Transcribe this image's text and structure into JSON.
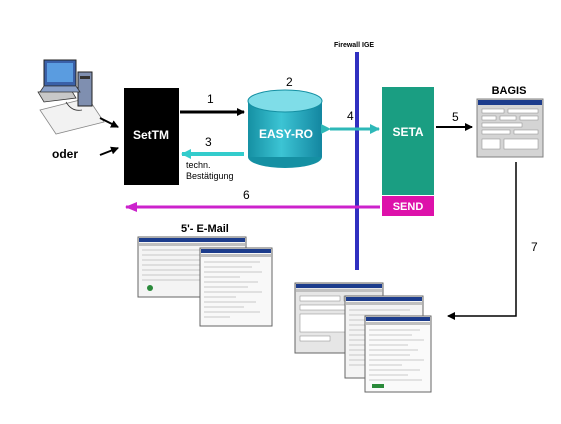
{
  "labels": {
    "firewall": "Firewall IGE",
    "settm": "SetTM",
    "easyro": "EASY-RO",
    "seta": "SETA",
    "send": "SEND",
    "bagis": "BAGIS",
    "oder": "oder",
    "techn1": "techn.",
    "techn2": "Bestätigung",
    "email": "5'- E-Mail"
  },
  "steps": {
    "s1": "1",
    "s2": "2",
    "s3": "3",
    "s4": "4",
    "s5": "5",
    "s6": "6",
    "s7": "7"
  },
  "colors": {
    "settm": "#000000",
    "easyro": "#1ba5b8",
    "seta": "#1a9e82",
    "send": "#dd11aa",
    "firewall": "#3030c0",
    "arrow3": "#33cccc",
    "arrow4": "#2eb8b8",
    "arrow6": "#cc22cc"
  }
}
